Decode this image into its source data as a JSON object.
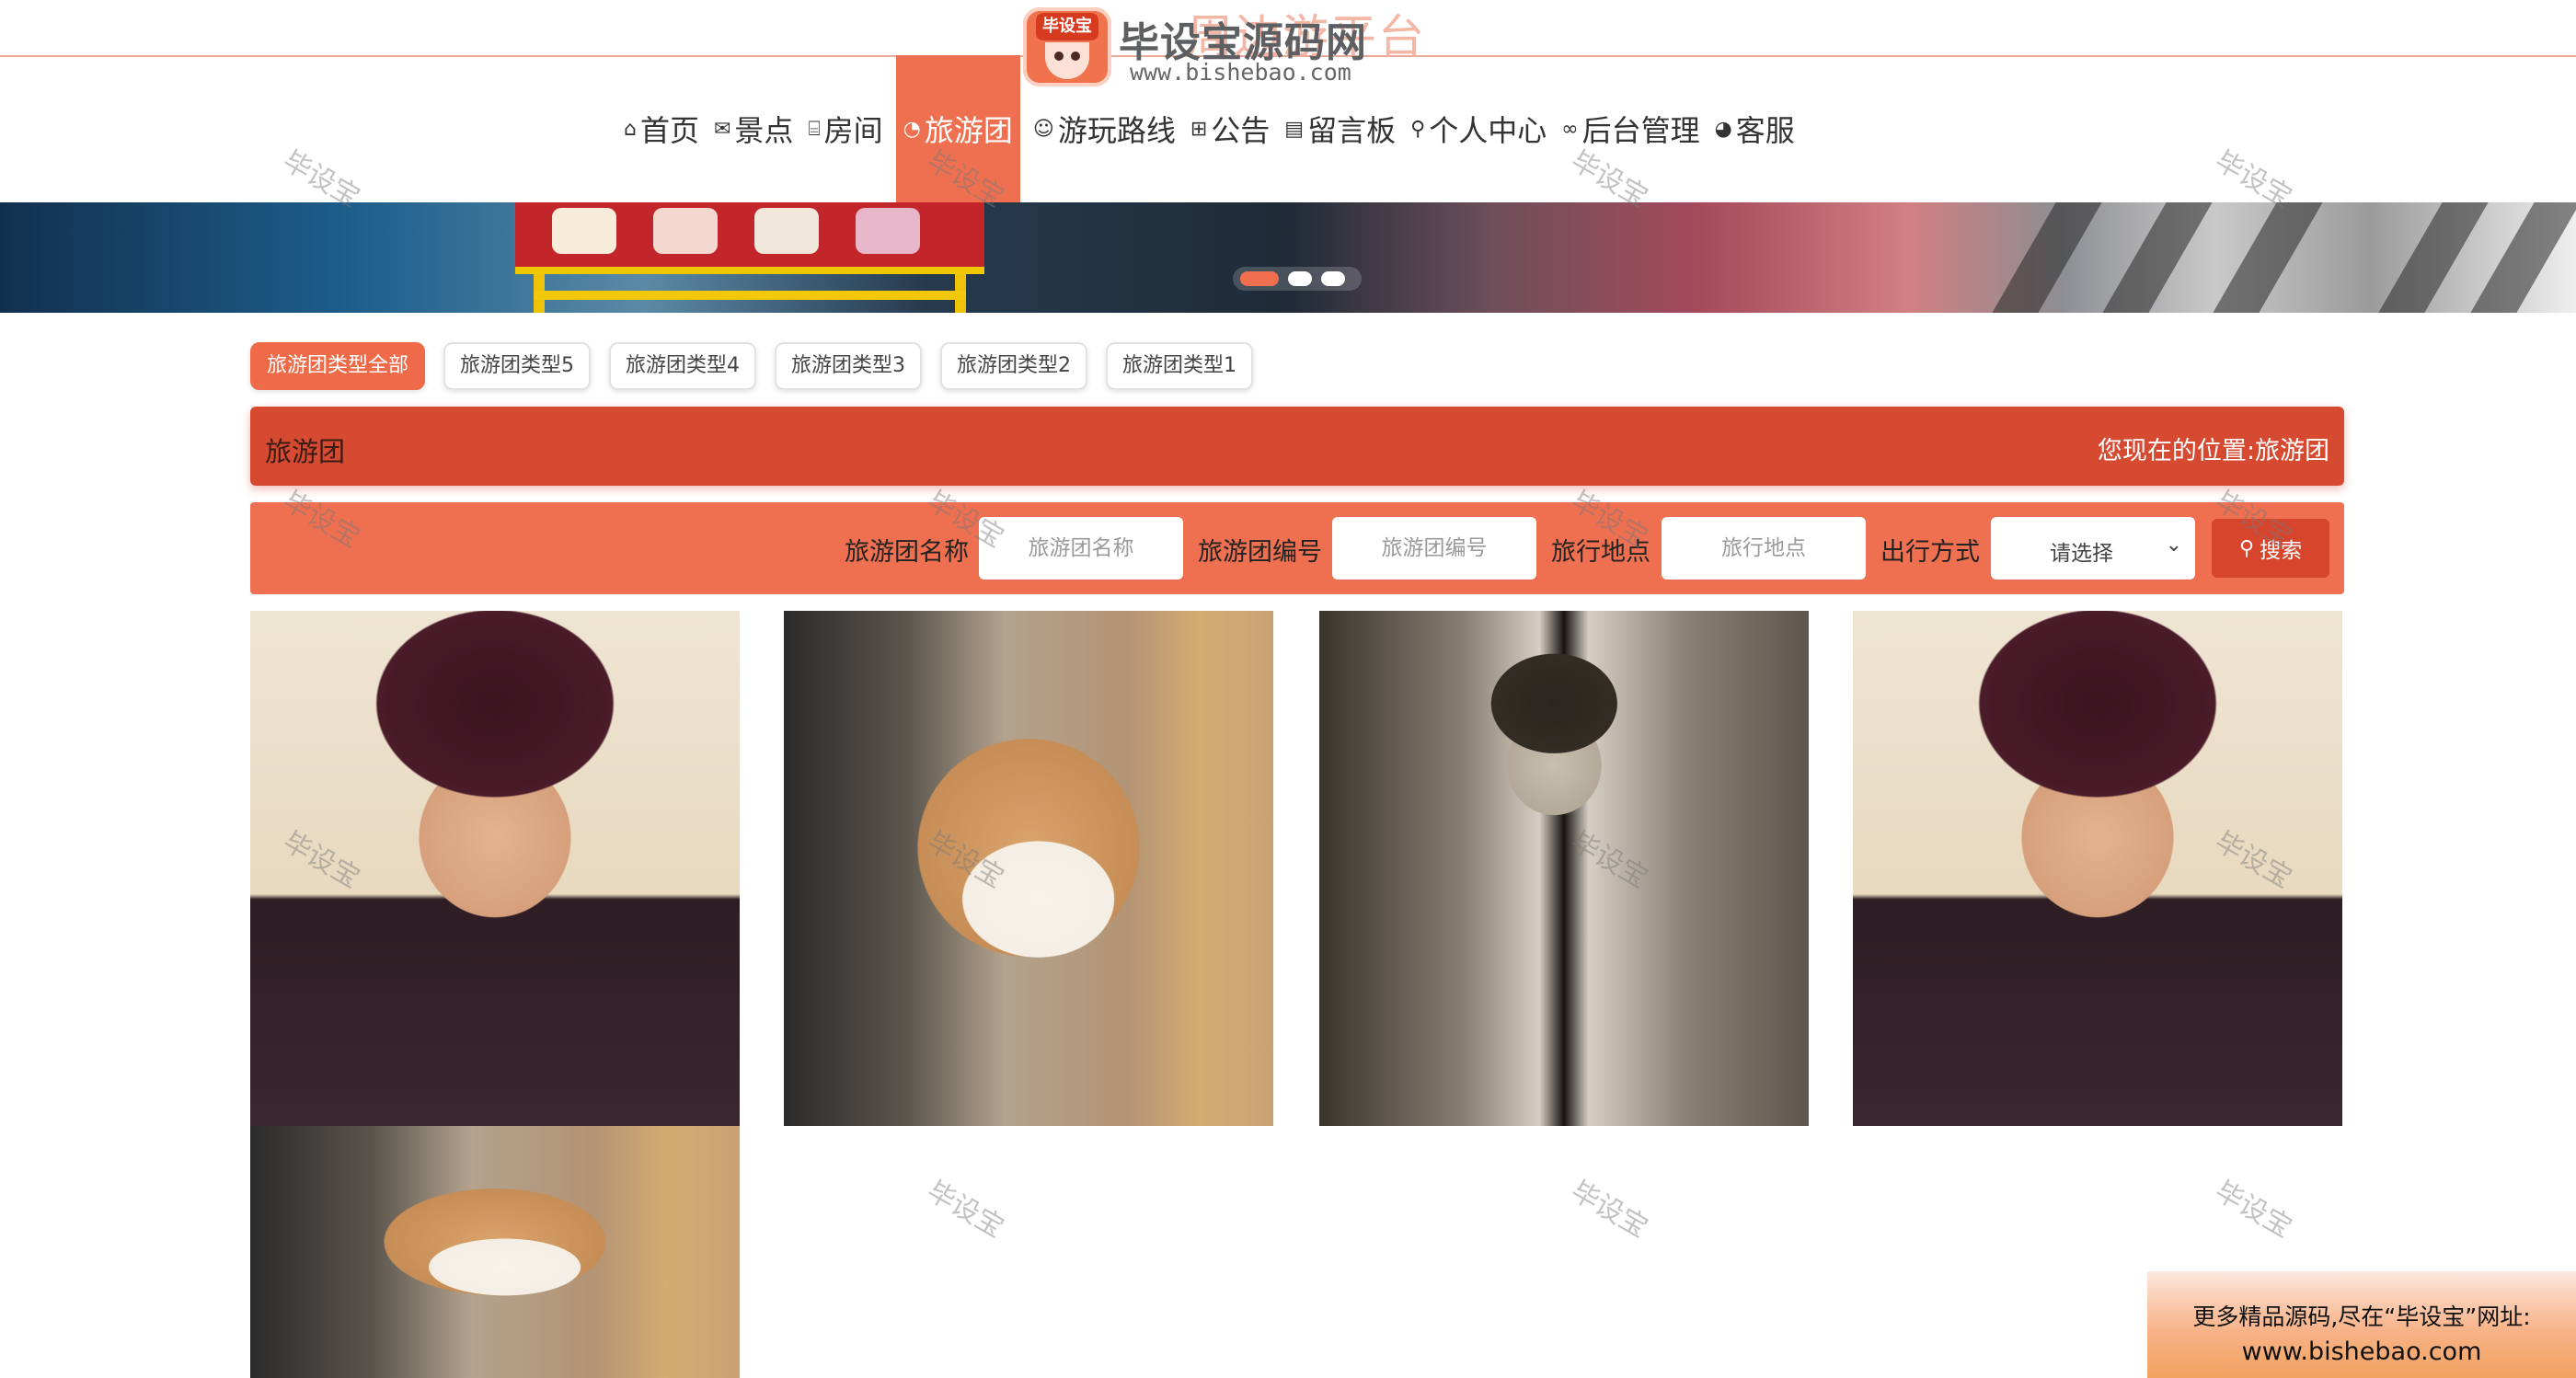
{
  "site": {
    "title_faded": "周边游平台",
    "logo": {
      "badge_text": "毕设宝",
      "brand": "毕设宝源码网",
      "url": "www.bishebao.com"
    }
  },
  "nav": [
    {
      "label": "首页",
      "icon": "home-icon",
      "glyph": "⌂",
      "active": false
    },
    {
      "label": "景点",
      "icon": "mail-icon",
      "glyph": "✉",
      "active": false
    },
    {
      "label": "房间",
      "icon": "gift-icon",
      "glyph": "⌸",
      "active": false
    },
    {
      "label": "旅游团",
      "icon": "dashboard-icon",
      "glyph": "◔",
      "active": true
    },
    {
      "label": "游玩路线",
      "icon": "palette-icon",
      "glyph": "☺",
      "active": false
    },
    {
      "label": "公告",
      "icon": "book-icon",
      "glyph": "⊞",
      "active": false
    },
    {
      "label": "留言板",
      "icon": "clipboard-icon",
      "glyph": "▤",
      "active": false
    },
    {
      "label": "个人中心",
      "icon": "person-icon",
      "glyph": "⚲",
      "active": false
    },
    {
      "label": "后台管理",
      "icon": "link-icon",
      "glyph": "∞",
      "active": false
    },
    {
      "label": "客服",
      "icon": "chat-icon",
      "glyph": "◕",
      "active": false
    }
  ],
  "banner": {
    "slides": 3,
    "active_slide": 1
  },
  "categories": [
    {
      "label": "旅游团类型全部",
      "active": true
    },
    {
      "label": "旅游团类型5",
      "active": false
    },
    {
      "label": "旅游团类型4",
      "active": false
    },
    {
      "label": "旅游团类型3",
      "active": false
    },
    {
      "label": "旅游团类型2",
      "active": false
    },
    {
      "label": "旅游团类型1",
      "active": false
    }
  ],
  "section": {
    "title": "旅游团",
    "location_label": "您现在的位置:",
    "location_value": "旅游团"
  },
  "search": {
    "name_label": "旅游团名称",
    "name_placeholder": "旅游团名称",
    "name_value": "",
    "code_label": "旅游团编号",
    "code_placeholder": "旅游团编号",
    "code_value": "",
    "place_label": "旅行地点",
    "place_placeholder": "旅行地点",
    "place_value": "",
    "mode_label": "出行方式",
    "mode_selected": "请选择",
    "button_label": "搜索",
    "button_icon": "search-icon"
  },
  "photos": [
    {
      "kind": "portrait"
    },
    {
      "kind": "dog"
    },
    {
      "kind": "bw-portrait"
    },
    {
      "kind": "portrait"
    },
    {
      "kind": "dog"
    }
  ],
  "watermark": "毕设宝",
  "ad": {
    "line1": "更多精品源码,尽在“毕设宝”网址:",
    "line2": "www.bishebao.com"
  },
  "colors": {
    "accent": "#ee7050",
    "accent_dark": "#d64a31",
    "active_cat": "#ee6a48"
  }
}
